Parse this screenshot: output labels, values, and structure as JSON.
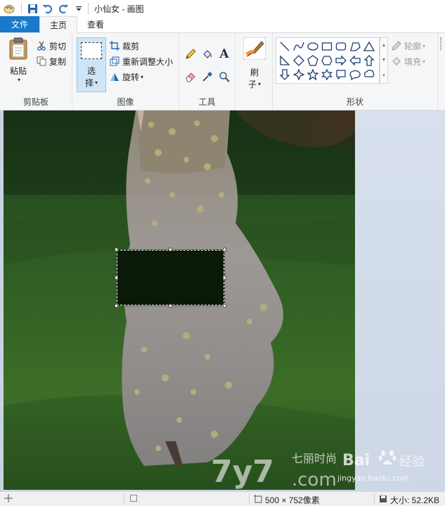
{
  "window": {
    "title": "小仙女 - 画图"
  },
  "tabs": [
    {
      "label": "文件"
    },
    {
      "label": "主页"
    },
    {
      "label": "查看"
    }
  ],
  "ribbon": {
    "clipboard": {
      "paste_label": "粘贴",
      "cut_label": "剪切",
      "copy_label": "复制",
      "group_label": "剪贴板"
    },
    "image": {
      "select_line1": "选",
      "select_line2": "择",
      "crop_label": "裁剪",
      "resize_label": "重新调整大小",
      "rotate_label": "旋转",
      "group_label": "图像"
    },
    "tools": {
      "group_label": "工具",
      "text_tool": "A"
    },
    "brushes": {
      "label_line1": "刷",
      "label_line2": "子"
    },
    "shapes": {
      "group_label": "形状",
      "outline_label": "轮廓",
      "fill_label": "填充"
    }
  },
  "canvas": {
    "watermark_logo": "7y7",
    "watermark_text1": "七丽时尚",
    "watermark_text2": ".com",
    "watermark_text3": "Bai",
    "watermark_text4": "经验",
    "watermark_url": "jingyan.baidu.com"
  },
  "status": {
    "dimensions": "500 × 752像素",
    "filesize": "大小: 52.2KB"
  },
  "colors": {
    "file_tab": "#1979ca",
    "ribbon_bg": "#f5f6f7",
    "canvas_bg": "#c8d3e2",
    "selection_fill": "#0b1a08"
  }
}
